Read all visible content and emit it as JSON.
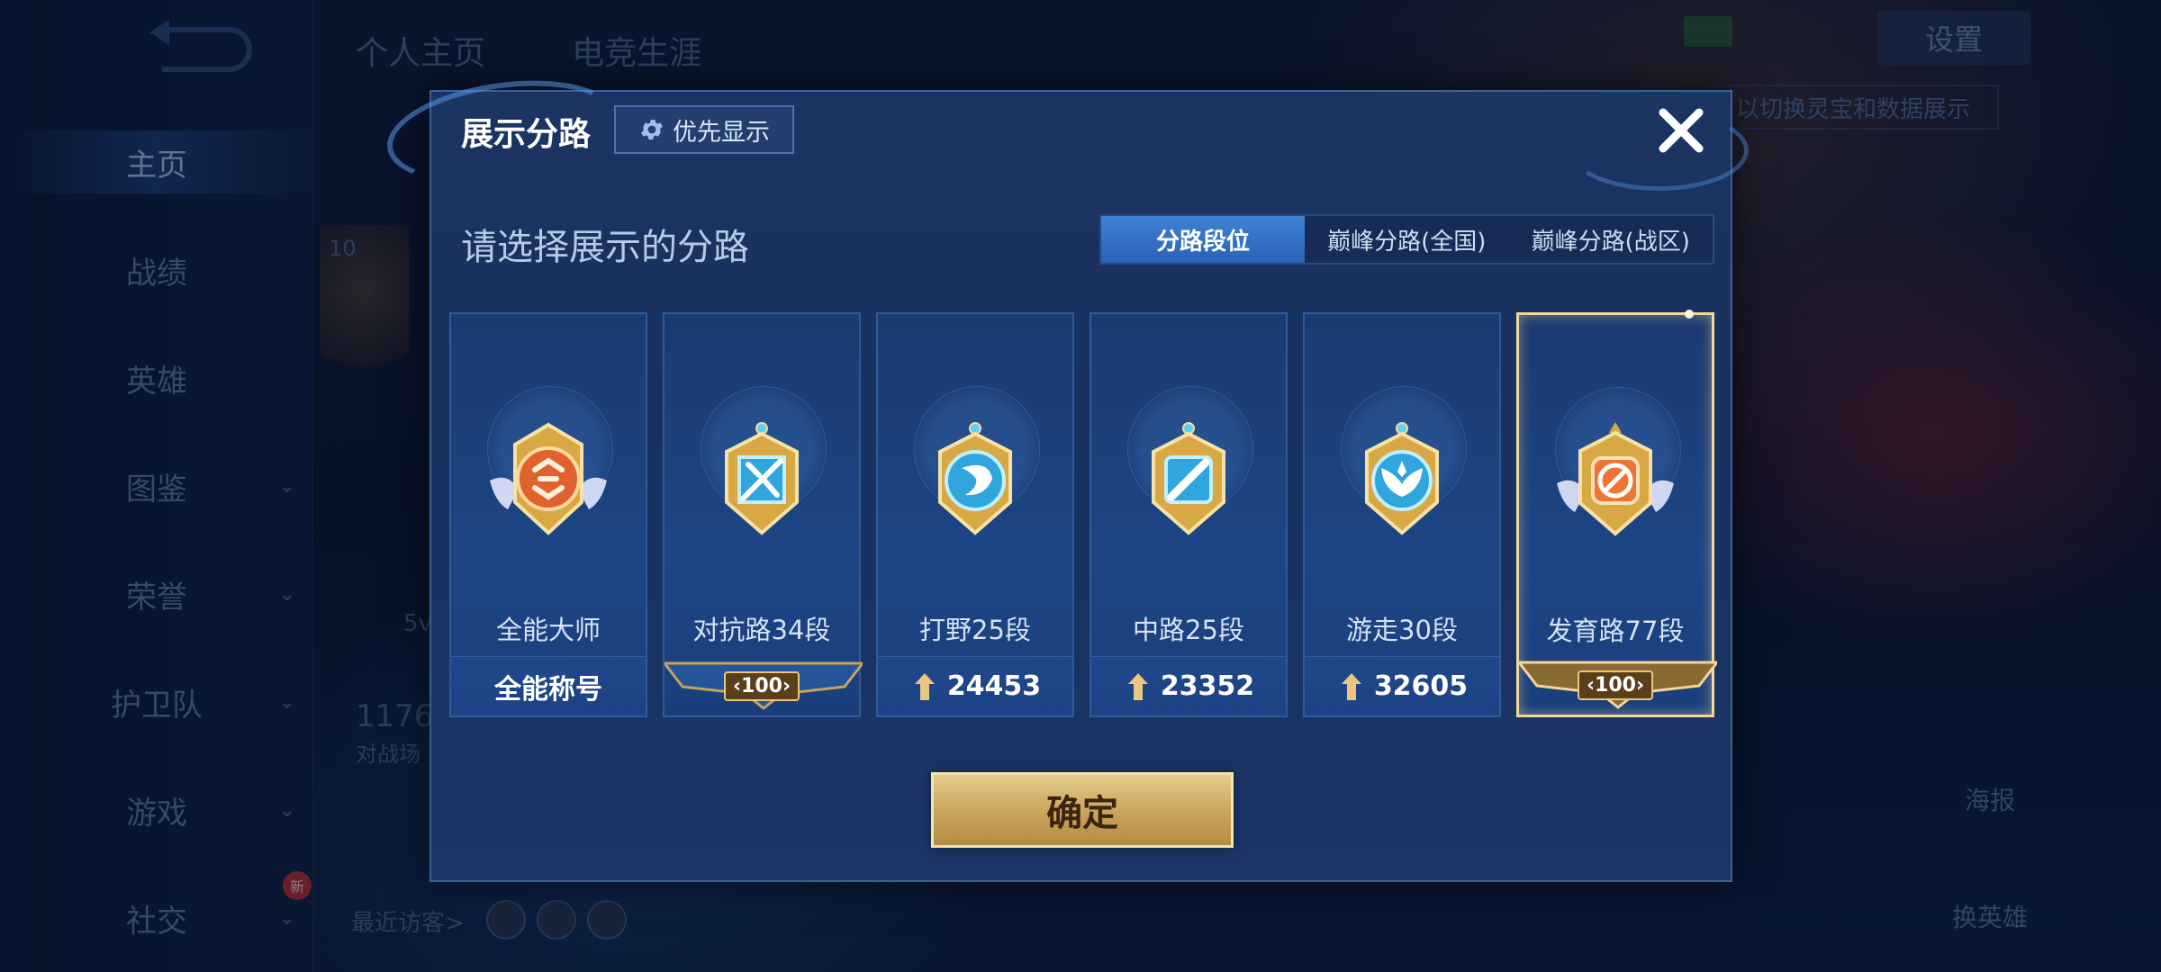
{
  "background": {
    "nav": [
      "主页",
      "战绩",
      "英雄",
      "图鉴",
      "荣誉",
      "护卫队",
      "游戏",
      "社交"
    ],
    "active_nav": "主页",
    "new_badge": "新",
    "top_tabs": [
      "个人主页",
      "电竞生涯"
    ],
    "settings_label": "设置",
    "hint": "以切换灵宝和数据展示",
    "poster_label": "海报",
    "switch_hero_label": "换英雄",
    "recent_visitors": "最近访客>",
    "level_badge": "10",
    "stat_number": "1176",
    "stat_caption": "对战场",
    "side_text": "5v"
  },
  "modal": {
    "title": "展示分路",
    "priority_label": "优先显示",
    "subtitle": "请选择展示的分路",
    "tabs": [
      "分路段位",
      "巅峰分路(全国)",
      "巅峰分路(战区)"
    ],
    "active_tab": 0,
    "confirm_label": "确定",
    "cards": [
      {
        "label": "全能大师",
        "footer": "全能称号",
        "footer_type": "plain",
        "badge_color": "#e0622e",
        "icon": "all-round-icon"
      },
      {
        "label": "对抗路34段",
        "footer": "100",
        "footer_type": "banner-blue",
        "badge_color": "#2fa6de",
        "icon": "clash-lane-icon"
      },
      {
        "label": "打野25段",
        "footer": "24453",
        "footer_type": "score",
        "badge_color": "#2fa6de",
        "icon": "jungle-icon"
      },
      {
        "label": "中路25段",
        "footer": "23352",
        "footer_type": "score",
        "badge_color": "#2fa6de",
        "icon": "mid-lane-icon"
      },
      {
        "label": "游走30段",
        "footer": "32605",
        "footer_type": "score",
        "badge_color": "#2fa6de",
        "icon": "roam-icon"
      },
      {
        "label": "发育路77段",
        "footer": "100",
        "footer_type": "banner-gold",
        "badge_color": "#ef7434",
        "icon": "farm-lane-icon",
        "selected": true
      }
    ]
  },
  "colors": {
    "accent_blue": "#3e82d6",
    "gold": "#e7cc8c",
    "modal_bg": "#1c3461"
  }
}
